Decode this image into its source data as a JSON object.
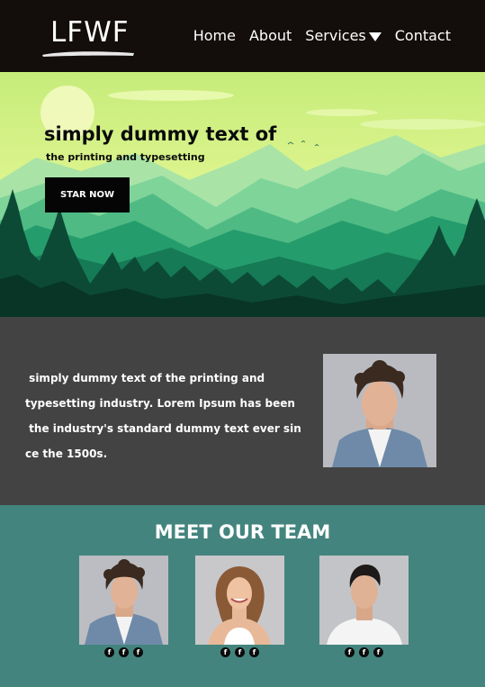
{
  "brand": {
    "logo_text": "LFWF"
  },
  "nav": {
    "items": [
      {
        "label": "Home"
      },
      {
        "label": "About"
      },
      {
        "label": "Services"
      },
      {
        "label": "Contact"
      }
    ]
  },
  "hero": {
    "title": "simply dummy text of",
    "subtitle": "the printing and typesetting",
    "button_label": "STAR NOW"
  },
  "about": {
    "lines": [
      " simply dummy text of the printing and",
      "typesetting industry. Lorem Ipsum has been",
      " the industry's standard dummy text ever sin",
      "ce the 1500s."
    ]
  },
  "team": {
    "title": "MEET OUR TEAM",
    "members": [
      {
        "social": [
          "f",
          "f",
          "f"
        ]
      },
      {
        "social": [
          "f",
          "f",
          "f"
        ]
      },
      {
        "social": [
          "f",
          "f",
          "f"
        ]
      }
    ]
  },
  "colors": {
    "nav_bg": "#130d0b",
    "about_bg": "#434343",
    "team_bg": "#43857e",
    "button_bg": "#050505"
  },
  "icons": {
    "caret": "caret-down-icon",
    "social": "facebook-icon"
  }
}
